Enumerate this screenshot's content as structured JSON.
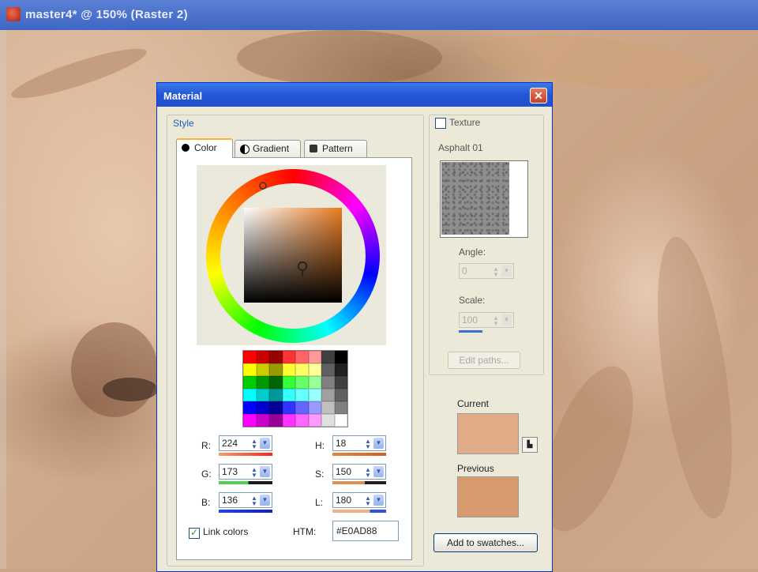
{
  "app": {
    "title": "master4* @ 150% (Raster 2)"
  },
  "dialog": {
    "title": "Material",
    "close_glyph": "✕",
    "style_label": "Style",
    "tabs": [
      {
        "label": "Color",
        "icon": "color-dot-icon"
      },
      {
        "label": "Gradient",
        "icon": "gradient-icon"
      },
      {
        "label": "Pattern",
        "icon": "pattern-icon"
      }
    ],
    "rgb": {
      "r_label": "R:",
      "r_value": "224",
      "g_label": "G:",
      "g_value": "173",
      "b_label": "B:",
      "b_value": "136"
    },
    "hsl": {
      "h_label": "H:",
      "h_value": "18",
      "s_label": "S:",
      "s_value": "150",
      "l_label": "L:",
      "l_value": "180"
    },
    "link_colors": {
      "label": "Link colors",
      "checked": true
    },
    "htm": {
      "label": "HTM:",
      "value": "#E0AD88"
    },
    "texture": {
      "label": "Texture",
      "checked": false,
      "name": "Asphalt 01"
    },
    "angle": {
      "label": "Angle:",
      "value": "0"
    },
    "scale": {
      "label": "Scale:",
      "value": "100"
    },
    "edit_paths_label": "Edit paths...",
    "current_label": "Current",
    "previous_label": "Previous",
    "add_swatch_label": "Add to swatches...",
    "colors": {
      "current": "#e0ad88",
      "previous": "#d79a6e",
      "accent": "#2356d6"
    }
  }
}
